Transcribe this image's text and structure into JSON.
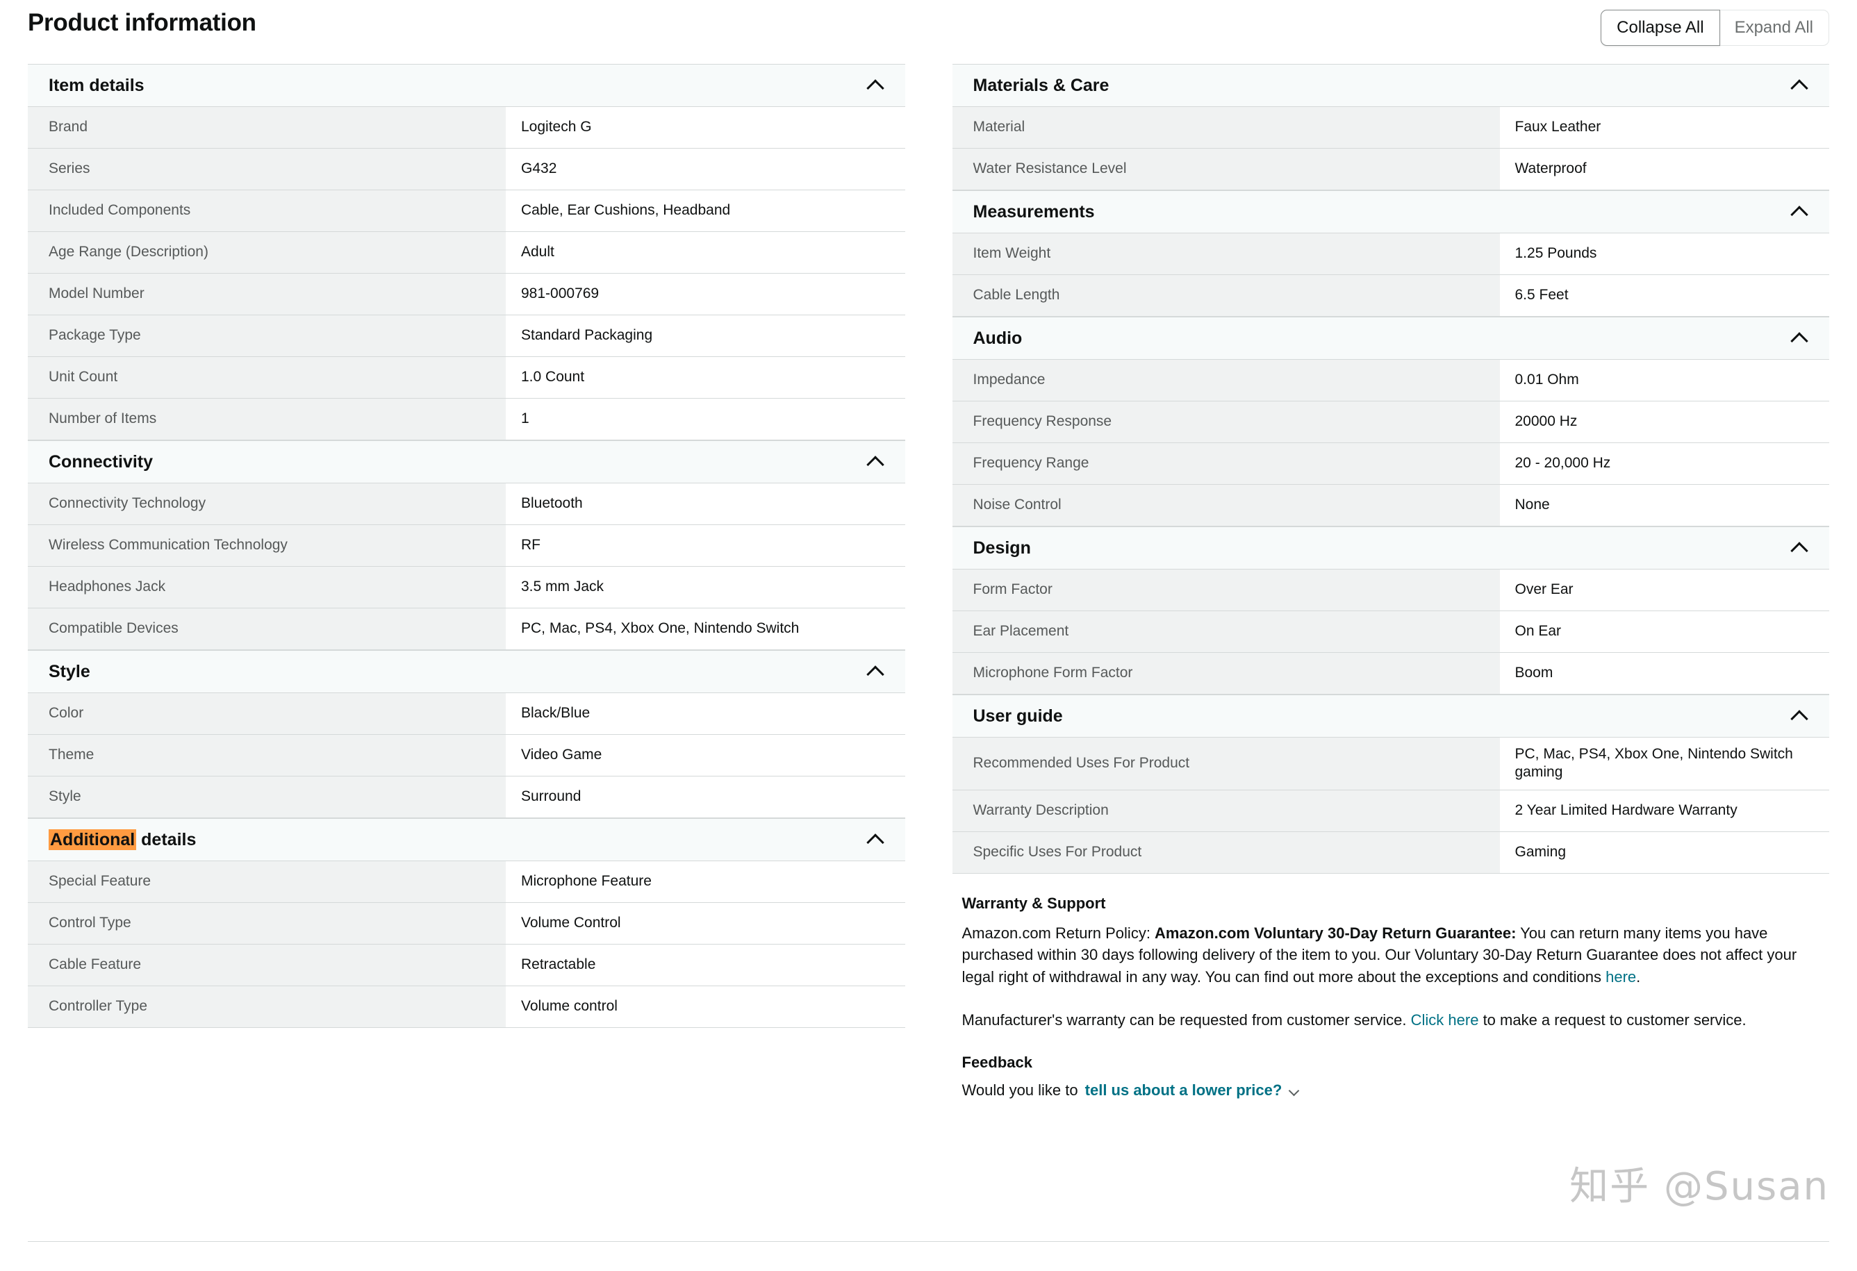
{
  "header": {
    "title": "Product information",
    "collapse_all_label": "Collapse All",
    "expand_all_label": "Expand All"
  },
  "left_column": {
    "sections": [
      {
        "title": "Item details",
        "collapse_icon": "chevron-up-icon",
        "rows": [
          {
            "key": "Brand",
            "value": "Logitech G"
          },
          {
            "key": "Series",
            "value": "G432"
          },
          {
            "key": "Included Components",
            "value": "Cable, Ear Cushions, Headband"
          },
          {
            "key": "Age Range (Description)",
            "value": "Adult"
          },
          {
            "key": "Model Number",
            "value": "981-000769"
          },
          {
            "key": "Package Type",
            "value": "Standard Packaging"
          },
          {
            "key": "Unit Count",
            "value": "1.0 Count"
          },
          {
            "key": "Number of Items",
            "value": "1"
          }
        ]
      },
      {
        "title": "Connectivity",
        "collapse_icon": "chevron-up-icon",
        "rows": [
          {
            "key": "Connectivity Technology",
            "value": "Bluetooth"
          },
          {
            "key": "Wireless Communication Technology",
            "value": "RF"
          },
          {
            "key": "Headphones Jack",
            "value": "3.5 mm Jack"
          },
          {
            "key": "Compatible Devices",
            "value": "PC, Mac, PS4, Xbox One, Nintendo Switch"
          }
        ]
      },
      {
        "title": "Style",
        "collapse_icon": "chevron-up-icon",
        "rows": [
          {
            "key": "Color",
            "value": "Black/Blue"
          },
          {
            "key": "Theme",
            "value": "Video Game"
          },
          {
            "key": "Style",
            "value": "Surround"
          }
        ]
      },
      {
        "title": "Additional details",
        "title_highlighted_part": "Additional",
        "title_rest_part": " details",
        "highlight_color": "#ff9b41",
        "collapse_icon": "chevron-up-icon",
        "rows": [
          {
            "key": "Special Feature",
            "value": "Microphone Feature"
          },
          {
            "key": "Control Type",
            "value": "Volume Control"
          },
          {
            "key": "Cable Feature",
            "value": "Retractable"
          },
          {
            "key": "Controller Type",
            "value": "Volume control"
          }
        ]
      }
    ]
  },
  "right_column": {
    "sections": [
      {
        "title": "Materials & Care",
        "collapse_icon": "chevron-up-icon",
        "rows": [
          {
            "key": "Material",
            "value": "Faux Leather"
          },
          {
            "key": "Water Resistance Level",
            "value": "Waterproof"
          }
        ]
      },
      {
        "title": "Measurements",
        "collapse_icon": "chevron-up-icon",
        "rows": [
          {
            "key": "Item Weight",
            "value": "1.25 Pounds"
          },
          {
            "key": "Cable Length",
            "value": "6.5 Feet"
          }
        ]
      },
      {
        "title": "Audio",
        "collapse_icon": "chevron-up-icon",
        "rows": [
          {
            "key": "Impedance",
            "value": "0.01 Ohm"
          },
          {
            "key": "Frequency Response",
            "value": "20000 Hz"
          },
          {
            "key": "Frequency Range",
            "value": "20 - 20,000 Hz"
          },
          {
            "key": "Noise Control",
            "value": "None"
          }
        ]
      },
      {
        "title": "Design",
        "collapse_icon": "chevron-up-icon",
        "rows": [
          {
            "key": "Form Factor",
            "value": "Over Ear"
          },
          {
            "key": "Ear Placement",
            "value": "On Ear"
          },
          {
            "key": "Microphone Form Factor",
            "value": "Boom"
          }
        ]
      },
      {
        "title": "User guide",
        "collapse_icon": "chevron-up-icon",
        "rows": [
          {
            "key": "Recommended Uses For Product",
            "value": "PC, Mac, PS4, Xbox One, Nintendo Switch gaming"
          },
          {
            "key": "Warranty Description",
            "value": "2 Year Limited Hardware Warranty"
          },
          {
            "key": "Specific Uses For Product",
            "value": "Gaming"
          }
        ]
      }
    ],
    "warranty": {
      "heading": "Warranty & Support",
      "p1_prefix": "Amazon.com Return Policy: ",
      "p1_bold": "Amazon.com Voluntary 30-Day Return Guarantee:",
      "p1_body": " You can return many items you have purchased within 30 days following delivery of the item to you. Our Voluntary 30-Day Return Guarantee does not affect your legal right of withdrawal in any way. You can find out more about the exceptions and conditions ",
      "p1_link": "here",
      "p1_suffix": ".",
      "p2_prefix": "Manufacturer's warranty can be requested from customer service. ",
      "p2_link": "Click here",
      "p2_suffix": " to make a request to customer service."
    },
    "feedback": {
      "heading": "Feedback",
      "prompt_prefix": "Would you like to ",
      "prompt_link": "tell us about a lower price?",
      "chevron_icon": "chevron-down-icon"
    }
  },
  "watermark": {
    "text": "知乎 @Susan"
  },
  "colors": {
    "link": "#007185",
    "section_header_bg": "#f7fafa",
    "key_cell_bg": "#f0f2f2",
    "border": "#d5d9d9",
    "highlight": "#ff9b41"
  }
}
